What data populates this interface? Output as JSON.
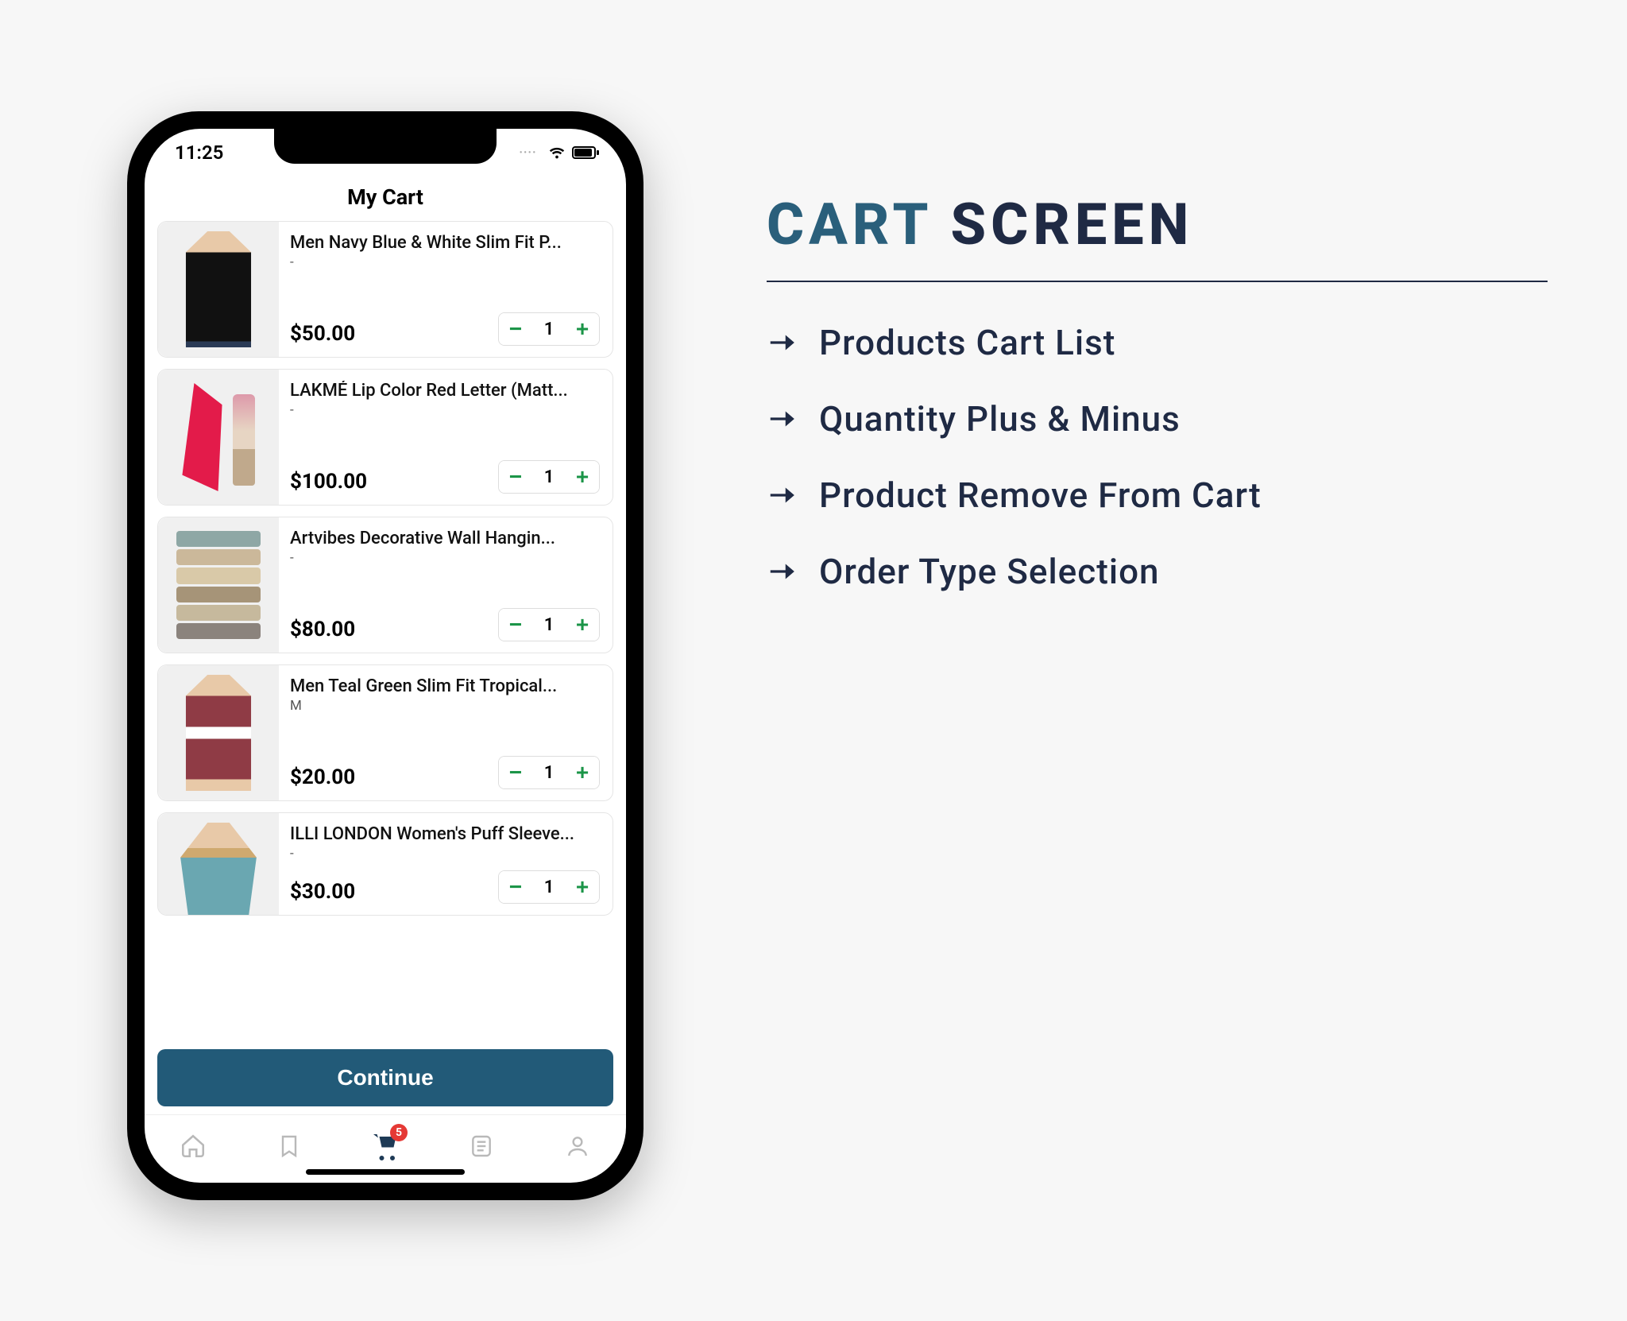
{
  "status": {
    "time": "11:25"
  },
  "page": {
    "title": "My Cart"
  },
  "cart": {
    "badge_count": "5",
    "continue_label": "Continue",
    "items": [
      {
        "name": "Men Navy Blue & White Slim Fit P...",
        "variant": "-",
        "price": "$50.00",
        "qty": "1",
        "thumb": "shirt-black"
      },
      {
        "name": "LAKMÉ Lip Color Red Letter (Matt...",
        "variant": "-",
        "price": "$100.00",
        "qty": "1",
        "thumb": "lipstick"
      },
      {
        "name": "Artvibes Decorative Wall Hangin...",
        "variant": "-",
        "price": "$80.00",
        "qty": "1",
        "thumb": "wall"
      },
      {
        "name": "Men Teal Green Slim Fit Tropical...",
        "variant": "M",
        "price": "$20.00",
        "qty": "1",
        "thumb": "shirt-teal"
      },
      {
        "name": "ILLI LONDON Women's Puff Sleeve...",
        "variant": "-",
        "price": "$30.00",
        "qty": "1",
        "thumb": "top-blue"
      }
    ]
  },
  "qty_labels": {
    "minus": "−",
    "plus": "+"
  },
  "desc": {
    "title_accent": "CART",
    "title_rest": "SCREEN",
    "features": [
      "Products Cart List",
      "Quantity Plus & Minus",
      "Product Remove From Cart",
      "Order Type Selection"
    ]
  },
  "colors": {
    "accent": "#225a78",
    "green": "#1a9447",
    "dark": "#1f2a44",
    "badge": "#e53935"
  }
}
